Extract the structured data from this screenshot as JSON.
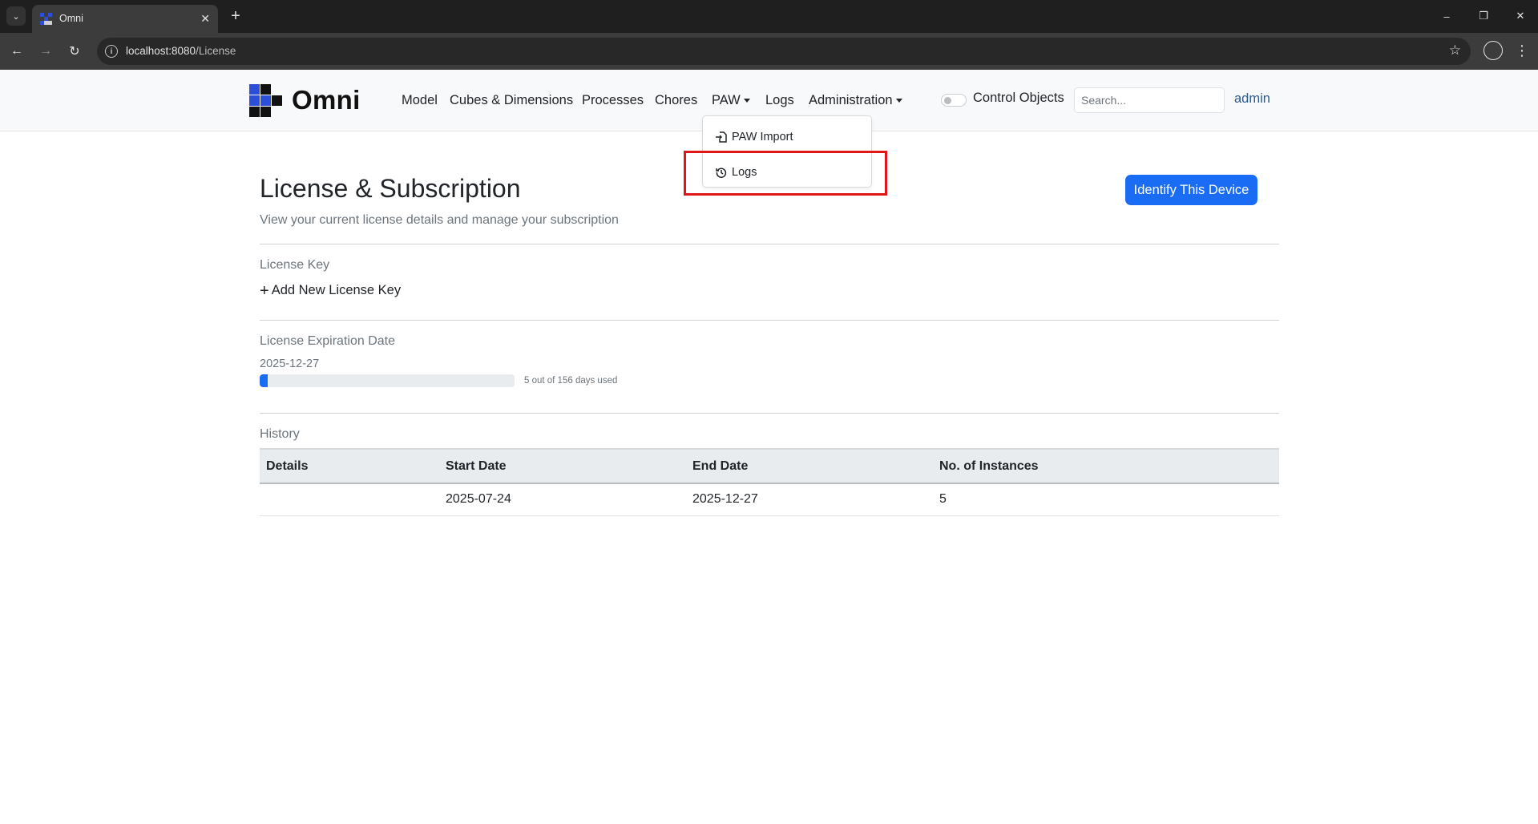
{
  "browser": {
    "tab_title": "Omni",
    "url_host": "localhost:8080",
    "url_path": "/License"
  },
  "app": {
    "brand": "Omni",
    "nav": {
      "model": "Model",
      "cubes": "Cubes & Dimensions",
      "processes": "Processes",
      "chores": "Chores",
      "paw": "PAW",
      "logs": "Logs",
      "administration": "Administration"
    },
    "control_objects_label": "Control Objects",
    "control_objects_on": false,
    "search_placeholder": "Search...",
    "user": "admin"
  },
  "dropdown": {
    "items": [
      {
        "label": "PAW Import",
        "icon": "file-import-icon"
      },
      {
        "label": "Logs",
        "icon": "history-icon"
      }
    ]
  },
  "page": {
    "title": "License & Subscription",
    "subtitle": "View your current license details and manage your subscription",
    "identify_button": "Identify This Device",
    "license_key_label": "License Key",
    "add_key_label": "Add New License Key",
    "expiration_label": "License Expiration Date",
    "expiration_date": "2025-12-27",
    "days_used": 5,
    "days_total": 156,
    "progress_text": "5 out of 156 days used",
    "history_label": "History",
    "history_columns": [
      "Details",
      "Start Date",
      "End Date",
      "No. of Instances"
    ],
    "history_rows": [
      [
        "",
        "2025-07-24",
        "2025-12-27",
        "5"
      ]
    ]
  },
  "colors": {
    "primary": "#1a6cf5",
    "highlight": "#e0161b",
    "brand_blue": "#2d4fd8"
  }
}
